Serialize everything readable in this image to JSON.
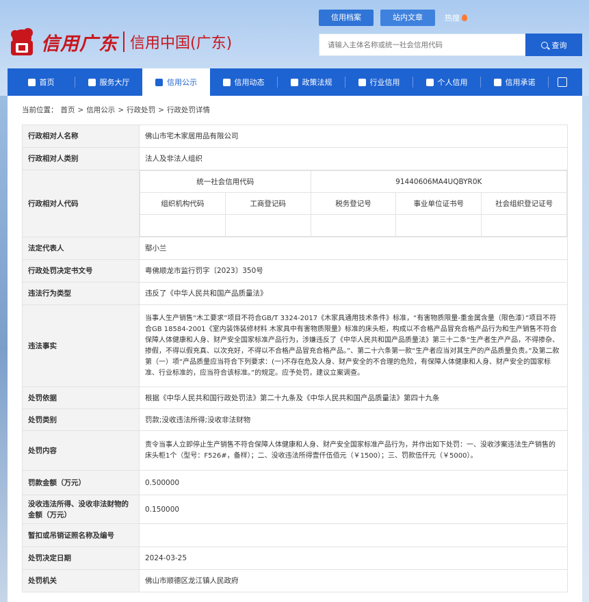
{
  "brand": {
    "script_name": "信用广东",
    "site_name": "信用中国(广东)"
  },
  "top_tabs": [
    {
      "label": "信用档案"
    },
    {
      "label": "站内文章"
    }
  ],
  "top_hot": "热搜",
  "search": {
    "placeholder": "请输入主体名称或统一社会信用代码",
    "button_label": "查询"
  },
  "nav": {
    "items": [
      {
        "label": "首页",
        "icon": "home-icon"
      },
      {
        "label": "服务大厅",
        "icon": "grid-icon"
      },
      {
        "label": "信用公示",
        "icon": "briefcase-icon"
      },
      {
        "label": "信用动态",
        "icon": "document-icon"
      },
      {
        "label": "政策法规",
        "icon": "book-icon"
      },
      {
        "label": "行业信用",
        "icon": "chart-icon"
      },
      {
        "label": "个人信用",
        "icon": "id-card-icon"
      },
      {
        "label": "信用承诺",
        "icon": "shield-icon"
      }
    ],
    "active_index": 2
  },
  "breadcrumb": {
    "prefix": "当前位置：",
    "items": [
      "首页",
      "信用公示",
      "行政处罚",
      "行政处罚详情"
    ],
    "separator": ">"
  },
  "detail": {
    "party_name_label": "行政相对人名称",
    "party_name": "佛山市宅木家居用品有限公司",
    "party_type_label": "行政相对人类别",
    "party_type": "法人及非法人组织",
    "party_code_label": "行政相对人代码",
    "uscc_label": "统一社会信用代码",
    "uscc": "91440606MA4UQBYR0K",
    "code_headers": [
      "组织机构代码",
      "工商登记码",
      "税务登记号",
      "事业单位证书号",
      "社会组织登记证号"
    ],
    "legal_rep_label": "法定代表人",
    "legal_rep": "鄢小兰",
    "doc_no_label": "行政处罚决定书文号",
    "doc_no": "粤佛顺龙市监行罚字〔2023〕350号",
    "violation_type_label": "违法行为类型",
    "violation_type": "违反了《中华人民共和国产品质量法》",
    "facts_label": "违法事实",
    "facts": "当事人生产销售“木工要求”项目不符合GB/T 3324-2017《木家具通用技术条件》标准，“有害物质限量-重金属含量（限色漆）”项目不符合GB 18584-2001《室内装饰装修材料 木家具中有害物质限量》标准的床头柜，构成以不合格产品冒充合格产品行为和生产销售不符合保障人体健康和人身、财产安全国家标准产品行为，涉嫌违反了《中华人民共和国产品质量法》第三十二条“生产者生产产品，不得掺杂、掺假，不得以假充真、以次充好，不得以不合格产品冒充合格产品。”、第二十六条第一款“生产者应当对其生产的产品质量负责。”及第二款第（一）项“产品质量应当符合下列要求：(一)不存在危及人身、财产安全的不合理的危险，有保障人体健康和人身、财产安全的国家标准、行业标准的，应当符合该标准。”的规定。应予处罚，建议立案调查。",
    "basis_label": "处罚依据",
    "basis": "根据《中华人民共和国行政处罚法》第二十九条及《中华人民共和国产品质量法》第四十九条",
    "category_label": "处罚类别",
    "category": "罚款;没收违法所得;没收非法财物",
    "content_label": "处罚内容",
    "content": "责令当事人立即停止生产销售不符合保障人体健康和人身、财产安全国家标准产品行为，并作出如下处罚：一、没收涉案违法生产销售的床头柜1个（型号：F526#，备样）；二、没收违法所得壹仟伍佰元（￥1500）；三、罚款伍仟元（￥5000）。",
    "fine_label": "罚款金额（万元）",
    "fine": "0.500000",
    "confiscation_label": "没收违法所得、没收非法财物的金额（万元）",
    "confiscation": "0.150000",
    "license_label": "暂扣或吊销证照名称及编号",
    "license": "",
    "decision_date_label": "处罚决定日期",
    "decision_date": "2024-03-25",
    "authority_label": "处罚机关",
    "authority": "佛山市顺德区龙江镇人民政府"
  }
}
